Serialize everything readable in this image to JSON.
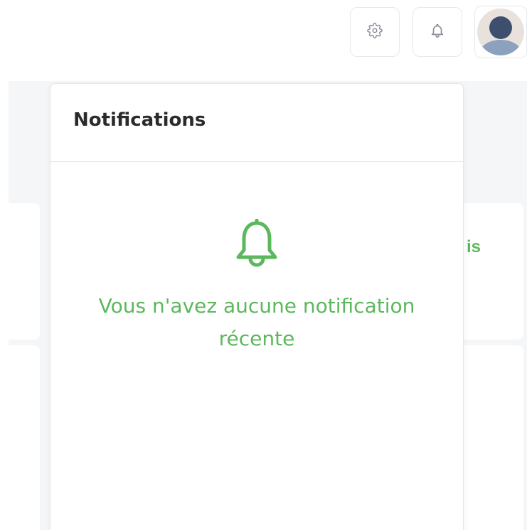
{
  "topbar": {
    "settings_icon": "gear-icon",
    "notifications_icon": "bell-icon",
    "avatar_icon": "user-avatar-icon"
  },
  "background": {
    "partial_card_text": "is"
  },
  "notifications_panel": {
    "title": "Notifications",
    "empty_icon": "bell-icon",
    "empty_message": "Vous n'avez aucune notification récente"
  },
  "colors": {
    "accent_green": "#5cb85c",
    "title_text": "#2b2b2b",
    "border": "#e4e6ea",
    "icon_gray": "#8a8f98"
  }
}
